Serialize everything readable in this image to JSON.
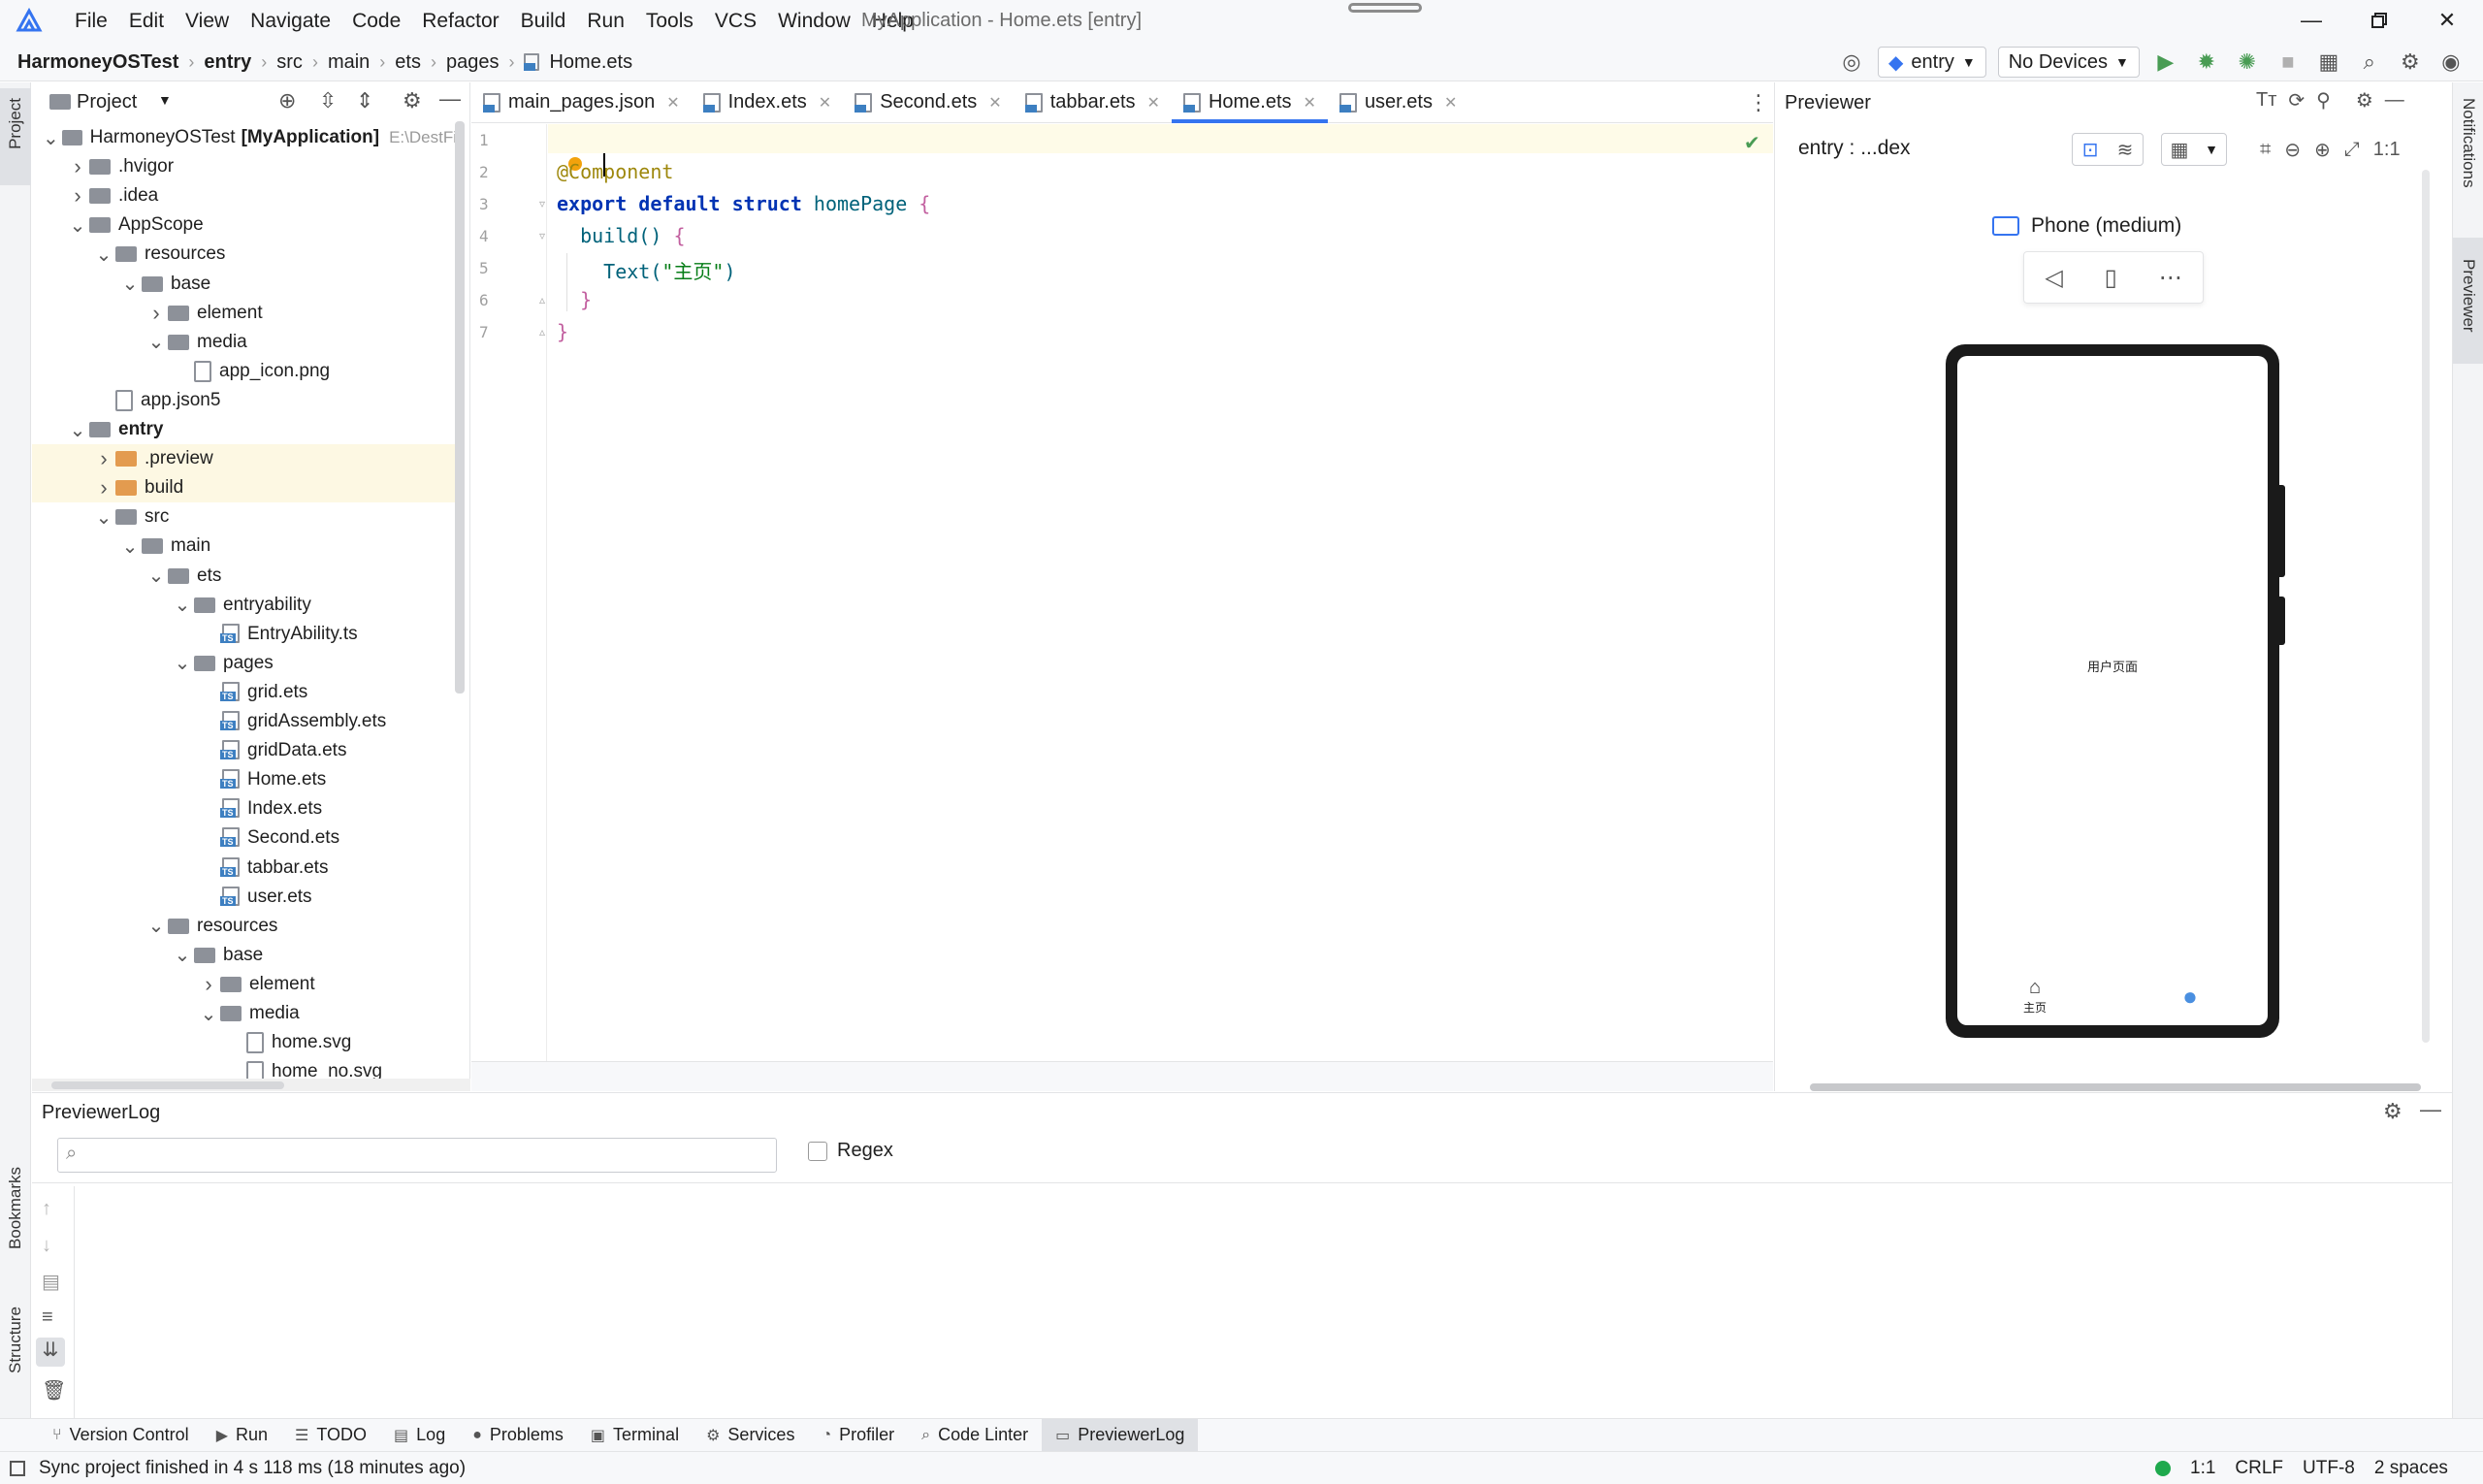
{
  "menubar": {
    "items": [
      "File",
      "Edit",
      "View",
      "Navigate",
      "Code",
      "Refactor",
      "Build",
      "Run",
      "Tools",
      "VCS",
      "Window",
      "Help"
    ],
    "window_title": "MyApplication - Home.ets [entry]"
  },
  "breadcrumb": {
    "items": [
      "HarmoneyOSTest",
      "entry",
      "src",
      "main",
      "ets",
      "pages",
      "Home.ets"
    ]
  },
  "toolbar": {
    "run_config": "entry",
    "device": "No Devices"
  },
  "left_strip": {
    "project": "Project",
    "bookmarks": "Bookmarks",
    "structure": "Structure"
  },
  "right_strip": {
    "notifications": "Notifications",
    "previewer": "Previewer"
  },
  "project": {
    "title": "Project",
    "root_name": "HarmoneyOSTest",
    "root_module": "[MyApplication]",
    "root_path": "E:\\DestFi",
    "tree": [
      {
        "label": "HarmoneyOSTest",
        "depth": 0,
        "kind": "root",
        "arrow": "open"
      },
      {
        "label": ".hvigor",
        "depth": 1,
        "kind": "folder",
        "arrow": "closed"
      },
      {
        "label": ".idea",
        "depth": 1,
        "kind": "folder",
        "arrow": "closed"
      },
      {
        "label": "AppScope",
        "depth": 1,
        "kind": "folder",
        "arrow": "open"
      },
      {
        "label": "resources",
        "depth": 2,
        "kind": "folder",
        "arrow": "open"
      },
      {
        "label": "base",
        "depth": 3,
        "kind": "folder",
        "arrow": "open"
      },
      {
        "label": "element",
        "depth": 4,
        "kind": "folder",
        "arrow": "closed"
      },
      {
        "label": "media",
        "depth": 4,
        "kind": "folder",
        "arrow": "open"
      },
      {
        "label": "app_icon.png",
        "depth": 5,
        "kind": "file",
        "arrow": ""
      },
      {
        "label": "app.json5",
        "depth": 2,
        "kind": "file",
        "arrow": ""
      },
      {
        "label": "entry",
        "depth": 1,
        "kind": "folder",
        "arrow": "open",
        "bold": true
      },
      {
        "label": ".preview",
        "depth": 2,
        "kind": "folder-orange",
        "arrow": "closed",
        "highlight": true
      },
      {
        "label": "build",
        "depth": 2,
        "kind": "folder-orange",
        "arrow": "closed",
        "highlight": true
      },
      {
        "label": "src",
        "depth": 2,
        "kind": "folder",
        "arrow": "open"
      },
      {
        "label": "main",
        "depth": 3,
        "kind": "folder",
        "arrow": "open"
      },
      {
        "label": "ets",
        "depth": 4,
        "kind": "folder",
        "arrow": "open"
      },
      {
        "label": "entryability",
        "depth": 5,
        "kind": "folder",
        "arrow": "open"
      },
      {
        "label": "EntryAbility.ts",
        "depth": 6,
        "kind": "ets",
        "arrow": ""
      },
      {
        "label": "pages",
        "depth": 5,
        "kind": "folder",
        "arrow": "open"
      },
      {
        "label": "grid.ets",
        "depth": 6,
        "kind": "ets",
        "arrow": ""
      },
      {
        "label": "gridAssembly.ets",
        "depth": 6,
        "kind": "ets",
        "arrow": ""
      },
      {
        "label": "gridData.ets",
        "depth": 6,
        "kind": "ets",
        "arrow": ""
      },
      {
        "label": "Home.ets",
        "depth": 6,
        "kind": "ets",
        "arrow": ""
      },
      {
        "label": "Index.ets",
        "depth": 6,
        "kind": "ets",
        "arrow": ""
      },
      {
        "label": "Second.ets",
        "depth": 6,
        "kind": "ets",
        "arrow": ""
      },
      {
        "label": "tabbar.ets",
        "depth": 6,
        "kind": "ets",
        "arrow": ""
      },
      {
        "label": "user.ets",
        "depth": 6,
        "kind": "ets",
        "arrow": ""
      },
      {
        "label": "resources",
        "depth": 4,
        "kind": "folder",
        "arrow": "open"
      },
      {
        "label": "base",
        "depth": 5,
        "kind": "folder",
        "arrow": "open"
      },
      {
        "label": "element",
        "depth": 6,
        "kind": "folder",
        "arrow": "closed"
      },
      {
        "label": "media",
        "depth": 6,
        "kind": "folder",
        "arrow": "open"
      },
      {
        "label": "home.svg",
        "depth": 7,
        "kind": "file",
        "arrow": ""
      },
      {
        "label": "home_no.svg",
        "depth": 7,
        "kind": "file",
        "arrow": ""
      }
    ]
  },
  "editor": {
    "tabs": [
      {
        "label": "main_pages.json",
        "active": false
      },
      {
        "label": "Index.ets",
        "active": false
      },
      {
        "label": "Second.ets",
        "active": false
      },
      {
        "label": "tabbar.ets",
        "active": false
      },
      {
        "label": "Home.ets",
        "active": true
      },
      {
        "label": "user.ets",
        "active": false
      }
    ],
    "line_numbers": [
      "1",
      "2",
      "3",
      "4",
      "5",
      "6",
      "7"
    ],
    "code": {
      "l2_ann": "@Component",
      "l3_kw": "export default struct",
      "l3_name": "homePage",
      "l3_brace": "{",
      "l4_fn": "build()",
      "l4_brace": "{",
      "l5_fn": "Text(",
      "l5_str": "\"主页\"",
      "l5_close": ")",
      "l6": "}",
      "l7": "}"
    }
  },
  "previewer": {
    "title": "Previewer",
    "target": "entry : ...dex",
    "device_label": "Phone (medium)",
    "ratio": "1:1",
    "screen_text": "用户页面",
    "tab_home_label": "主页"
  },
  "log": {
    "title": "PreviewerLog",
    "search_placeholder": "",
    "regex_label": "Regex"
  },
  "tool_windows": [
    {
      "label": "Version Control",
      "icon": "branch-icon",
      "active": false
    },
    {
      "label": "Run",
      "icon": "play-icon",
      "active": false
    },
    {
      "label": "TODO",
      "icon": "list-icon",
      "active": false
    },
    {
      "label": "Log",
      "icon": "log-icon",
      "active": false
    },
    {
      "label": "Problems",
      "icon": "problems-icon",
      "active": false
    },
    {
      "label": "Terminal",
      "icon": "terminal-icon",
      "active": false
    },
    {
      "label": "Services",
      "icon": "services-icon",
      "active": false
    },
    {
      "label": "Profiler",
      "icon": "profiler-icon",
      "active": false
    },
    {
      "label": "Code Linter",
      "icon": "linter-icon",
      "active": false
    },
    {
      "label": "PreviewerLog",
      "icon": "previewer-log-icon",
      "active": true
    }
  ],
  "status": {
    "message": "Sync project finished in 4 s 118 ms (18 minutes ago)",
    "position": "1:1",
    "line_sep": "CRLF",
    "encoding": "UTF-8",
    "indent": "2 spaces"
  },
  "colors": {
    "accent": "#3574f0",
    "run_green": "#499c54",
    "highlight_row": "#fdf8e3"
  }
}
